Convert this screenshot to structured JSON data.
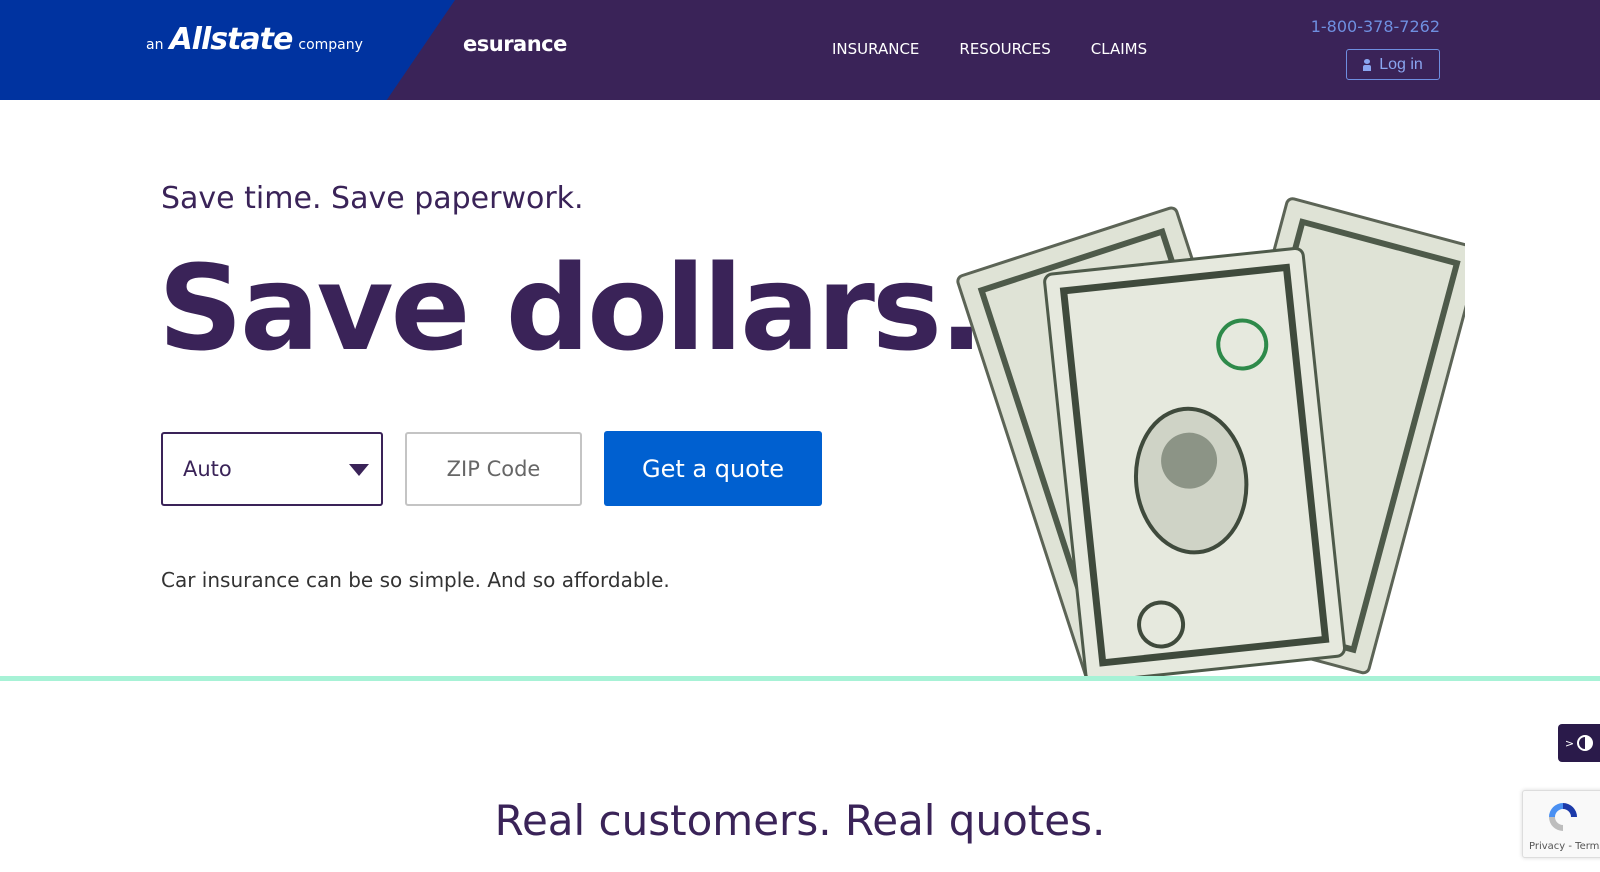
{
  "header": {
    "parent_brand": {
      "prefix": "an",
      "name": "Allstate",
      "suffix": "company"
    },
    "brand": "esurance",
    "nav": [
      "INSURANCE",
      "RESOURCES",
      "CLAIMS"
    ],
    "phone": "1-800-378-7262",
    "login_label": "Log in"
  },
  "hero": {
    "kicker": "Save time. Save paperwork.",
    "headline": "Save dollars.",
    "select_value": "Auto",
    "zip_placeholder": "ZIP Code",
    "cta_label": "Get a quote",
    "subtext": "Car insurance can be so simple. And so affordable."
  },
  "section": {
    "title": "Real customers. Real quotes."
  },
  "widgets": {
    "contrast_toggle": ">",
    "recaptcha_links": "Privacy - Terms"
  },
  "colors": {
    "brand_purple": "#3a2358",
    "allstate_blue": "#0033a0",
    "cta_blue": "#0060d0",
    "accent_mint": "#a7f2d6"
  }
}
